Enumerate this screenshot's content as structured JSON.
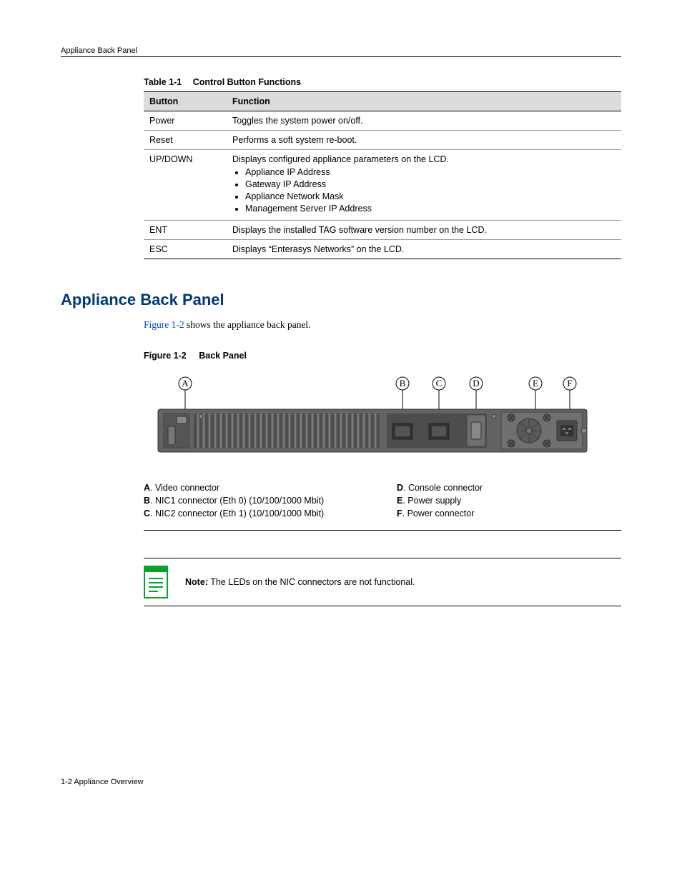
{
  "header": "Appliance Back Panel",
  "table_caption_num": "Table 1-1",
  "table_caption_title": "Control Button Functions",
  "table_headers": {
    "col1": "Button",
    "col2": "Function"
  },
  "rows": {
    "power": {
      "btn": "Power",
      "fn": "Toggles the system power on/off."
    },
    "reset": {
      "btn": "Reset",
      "fn": "Performs a soft system re-boot."
    },
    "updown": {
      "btn": "UP/DOWN",
      "fn": "Displays configured appliance parameters on the LCD.",
      "opts": [
        "Appliance IP Address",
        "Gateway IP Address",
        "Appliance Network Mask",
        "Management Server IP Address"
      ]
    },
    "ent": {
      "btn": "ENT",
      "fn": "Displays the installed TAG software version number on the LCD."
    },
    "esc": {
      "btn": "ESC",
      "fn": "Displays “Enterasys Networks” on the LCD."
    }
  },
  "section_heading": "Appliance Back Panel",
  "intro_xref": "Figure 1‑2",
  "intro_rest": " shows the appliance back panel.",
  "fig_caption_num": "Figure 1-2",
  "fig_caption_title": "Back Panel",
  "callouts": {
    "A": "A",
    "B": "B",
    "C": "C",
    "D": "D",
    "E": "E",
    "F": "F"
  },
  "legend": {
    "A": {
      "lbl": "A",
      "txt": ". Video connector"
    },
    "B": {
      "lbl": "B",
      "txt": ". NIC1 connector (Eth 0) (10/100/1000 Mbit)"
    },
    "C": {
      "lbl": "C",
      "txt": ". NIC2 connector (Eth 1) (10/100/1000 Mbit)"
    },
    "D": {
      "lbl": "D",
      "txt": ". Console connector"
    },
    "E": {
      "lbl": "E",
      "txt": ". Power supply"
    },
    "F": {
      "lbl": "F",
      "txt": ". Power connector"
    }
  },
  "note_label": "Note:",
  "note_text": " The LEDs on the NIC connectors are not functional.",
  "footer": "1-2   Appliance Overview"
}
